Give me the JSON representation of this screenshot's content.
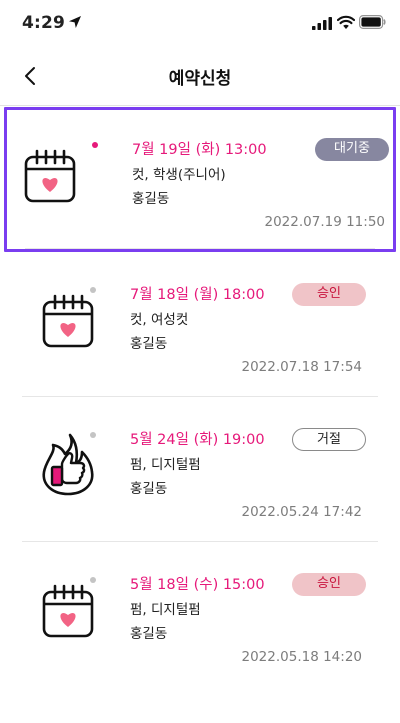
{
  "status_bar": {
    "time": "4:29"
  },
  "header": {
    "title": "예약신청"
  },
  "reservations": [
    {
      "datetime": "7월 19일 (화) 13:00",
      "service": "컷, 학생(주니어)",
      "name": "홍길동",
      "timestamp": "2022.07.19 11:50",
      "status": "대기중",
      "status_type": "waiting",
      "icon": "calendar-heart-icon",
      "unread": true
    },
    {
      "datetime": "7월 18일 (월) 18:00",
      "service": "컷, 여성컷",
      "name": "홍길동",
      "timestamp": "2022.07.18 17:54",
      "status": "승인",
      "status_type": "approved",
      "icon": "calendar-heart-icon",
      "unread": false
    },
    {
      "datetime": "5월 24일 (화) 19:00",
      "service": "펌, 디지털펌",
      "name": "홍길동",
      "timestamp": "2022.05.24 17:42",
      "status": "거절",
      "status_type": "rejected",
      "icon": "flame-thumbs-up-icon",
      "unread": false
    },
    {
      "datetime": "5월 18일 (수) 15:00",
      "service": "펌, 디지털펌",
      "name": "홍길동",
      "timestamp": "2022.05.18 14:20",
      "status": "승인",
      "status_type": "approved",
      "icon": "calendar-heart-icon",
      "unread": false
    }
  ],
  "colors": {
    "accent_pink": "#e6197a",
    "selection_purple": "#7a3df0",
    "waiting_badge": "#8787a0",
    "approved_badge": "#f0c4c8"
  }
}
